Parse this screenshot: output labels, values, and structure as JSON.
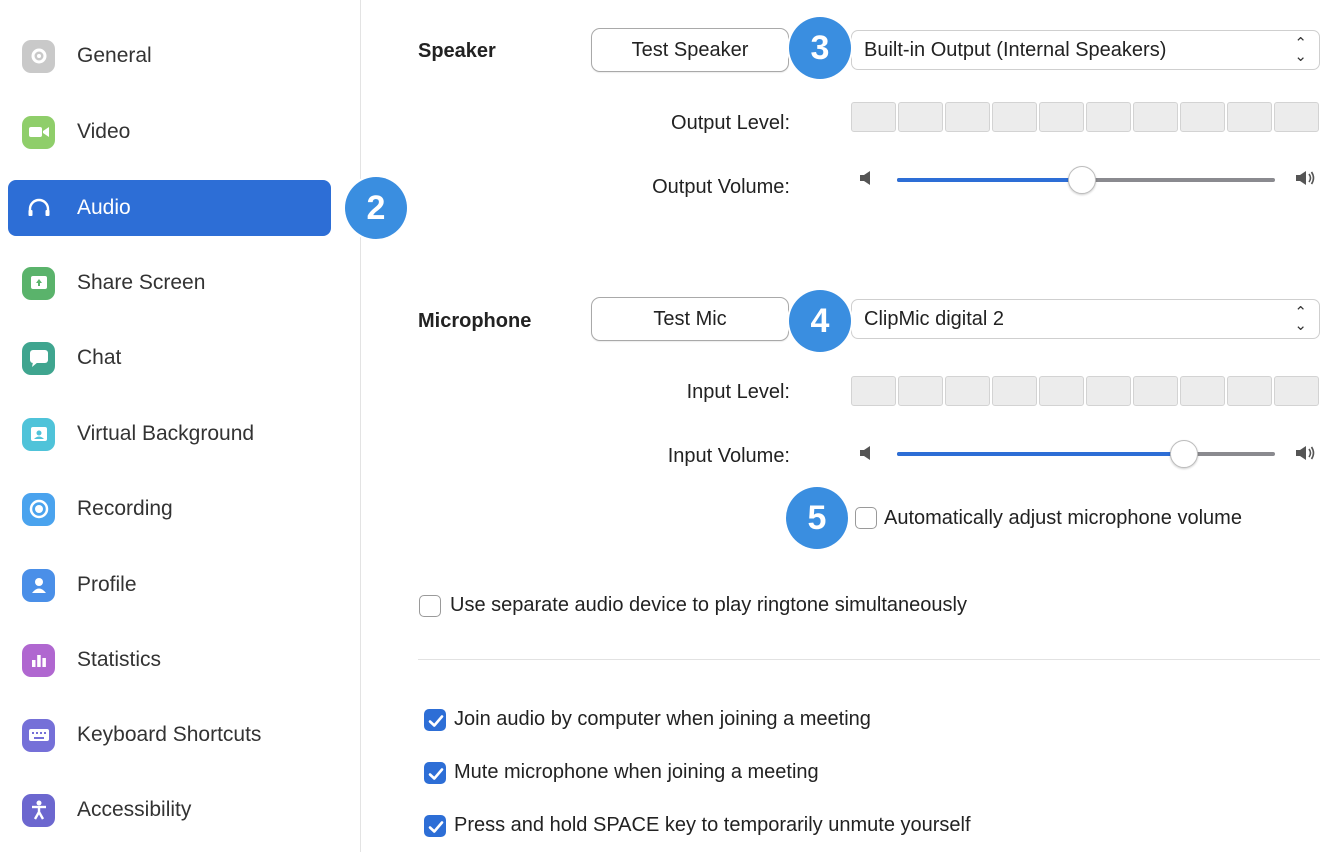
{
  "sidebar": {
    "items": [
      {
        "label": "General",
        "icon": "gear-icon",
        "color": "#c9c9c9"
      },
      {
        "label": "Video",
        "icon": "video-camera-icon",
        "color": "#8fce6a"
      },
      {
        "label": "Audio",
        "icon": "headphones-icon",
        "color": "#2d6ed6"
      },
      {
        "label": "Share Screen",
        "icon": "share-screen-icon",
        "color": "#5ab36b"
      },
      {
        "label": "Chat",
        "icon": "chat-bubble-icon",
        "color": "#3fa58f"
      },
      {
        "label": "Virtual Background",
        "icon": "virtual-background-icon",
        "color": "#4fc3d9"
      },
      {
        "label": "Recording",
        "icon": "record-icon",
        "color": "#4aa3ee"
      },
      {
        "label": "Profile",
        "icon": "profile-icon",
        "color": "#4a8fe8"
      },
      {
        "label": "Statistics",
        "icon": "statistics-icon",
        "color": "#b067d0"
      },
      {
        "label": "Keyboard Shortcuts",
        "icon": "keyboard-icon",
        "color": "#7570d8"
      },
      {
        "label": "Accessibility",
        "icon": "accessibility-icon",
        "color": "#6c67cf"
      }
    ],
    "active_index": 2
  },
  "badges": {
    "audio": "2",
    "speaker": "3",
    "microphone": "4",
    "auto_adjust": "5"
  },
  "speaker": {
    "label": "Speaker",
    "test_button": "Test Speaker",
    "device": "Built-in Output (Internal Speakers)",
    "level_label": "Output Level:",
    "volume_label": "Output Volume:",
    "volume_fraction": 0.49
  },
  "microphone": {
    "label": "Microphone",
    "test_button": "Test Mic",
    "device": "ClipMic digital 2",
    "level_label": "Input Level:",
    "volume_label": "Input Volume:",
    "volume_fraction": 0.76,
    "auto_adjust_label": "Automatically adjust microphone volume",
    "auto_adjust_checked": false
  },
  "options": {
    "ringtone_label": "Use separate audio device to play ringtone simultaneously",
    "ringtone_checked": false,
    "join_audio_label": "Join audio by computer when joining a meeting",
    "join_audio_checked": true,
    "mute_label": "Mute microphone when joining a meeting",
    "mute_checked": true,
    "space_label": "Press and hold SPACE key to temporarily unmute yourself",
    "space_checked": true
  },
  "colors": {
    "accent": "#2d6ed6",
    "badge": "#3a8ee0"
  }
}
